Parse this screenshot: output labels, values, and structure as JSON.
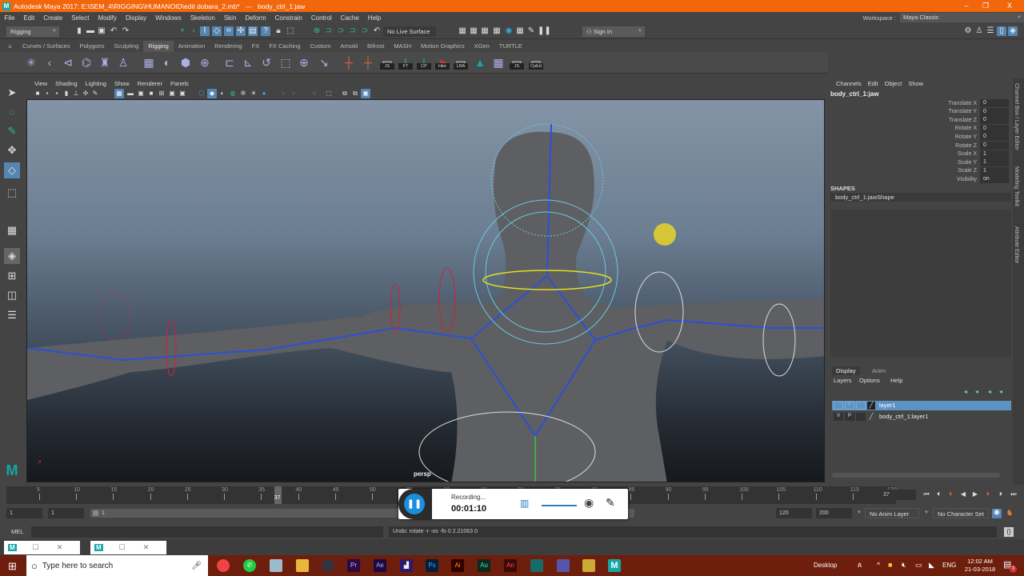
{
  "titlebar": {
    "title": "Autodesk Maya 2017: E:\\SEM_4\\RIGGING\\HUMANOID\\edit dobara_2.mb*   ---   body_ctrl_1:jaw",
    "logo": "M",
    "minimize": "–",
    "restore": "❐",
    "close": "X"
  },
  "menubar": [
    "File",
    "Edit",
    "Create",
    "Select",
    "Modify",
    "Display",
    "Windows",
    "Skeleton",
    "Skin",
    "Deform",
    "Constrain",
    "Control",
    "Cache",
    "Help"
  ],
  "workspace": {
    "label": "Workspace :",
    "value": "Maya Classic"
  },
  "statusline": {
    "menuset": "Rigging",
    "live_surface": "No Live Surface",
    "sign_in": "Sign In"
  },
  "shelf": {
    "tabs": [
      "Curves / Surfaces",
      "Polygons",
      "Sculpting",
      "Rigging",
      "Animation",
      "Rendering",
      "FX",
      "FX Caching",
      "Custom",
      "Arnold",
      "Bifrost",
      "MASH",
      "Motion Graphics",
      "XGen",
      "TURTLE"
    ],
    "active_tab": "Rigging",
    "labeled_buttons": [
      "JS",
      "FT",
      "CP",
      "Hier",
      "LRA",
      "JS",
      "CpEd"
    ]
  },
  "viewport": {
    "menu": [
      "View",
      "Shading",
      "Lighting",
      "Show",
      "Renderer",
      "Panels"
    ],
    "camera_label": "persp"
  },
  "channel_box": {
    "menu": [
      "Channels",
      "Edit",
      "Object",
      "Show"
    ],
    "object_name": "body_ctrl_1:jaw",
    "channels": [
      {
        "label": "Translate X",
        "value": "0"
      },
      {
        "label": "Translate Y",
        "value": "0"
      },
      {
        "label": "Translate Z",
        "value": "0"
      },
      {
        "label": "Rotate X",
        "value": "0"
      },
      {
        "label": "Rotate Y",
        "value": "0"
      },
      {
        "label": "Rotate Z",
        "value": "0"
      },
      {
        "label": "Scale X",
        "value": "1"
      },
      {
        "label": "Scale Y",
        "value": "1"
      },
      {
        "label": "Scale Z",
        "value": "1"
      },
      {
        "label": "Visibility",
        "value": "on"
      }
    ],
    "shapes_header": "SHAPES",
    "shape_name": "body_ctrl_1:jawShape"
  },
  "side_tabs": [
    "Channel Box / Layer Editor",
    "Modeling Toolkit",
    "Attribute Editor"
  ],
  "layer_editor": {
    "tabs": [
      "Display",
      "Anim"
    ],
    "active_tab": "Display",
    "menu": [
      "Layers",
      "Options",
      "Help"
    ],
    "layers": [
      {
        "v": "",
        "p": "P",
        "name": "layer1",
        "selected": true
      },
      {
        "v": "V",
        "p": "P",
        "name": "body_ctrl_1:layer1",
        "selected": false
      }
    ]
  },
  "time_slider": {
    "ticks": [
      "5",
      "10",
      "15",
      "20",
      "25",
      "30",
      "35",
      "40",
      "45",
      "50",
      "55",
      "60",
      "65",
      "70",
      "75",
      "80",
      "85",
      "90",
      "95",
      "100",
      "105",
      "110",
      "115",
      "120"
    ],
    "current_frame": "37",
    "current_frame_field": "37"
  },
  "range_slider": {
    "start_time": "1",
    "playback_start": "1",
    "range_label": "1",
    "playback_end": "120",
    "end_time": "200",
    "anim_layer": "No Anim Layer",
    "character_set": "No Character Set"
  },
  "command_line": {
    "language": "MEL",
    "input": "",
    "result": "Undo: rotate -r -os -fo 0 2.21063 0"
  },
  "recorder": {
    "status": "Recording...",
    "time": "00:01:10"
  },
  "mini_windows": [
    {
      "icon": "M"
    },
    {
      "icon": "M"
    }
  ],
  "taskbar": {
    "search_placeholder": "Type here to search",
    "apps": [
      "Chrome",
      "WhatsApp",
      "Notes",
      "File Explorer",
      "DaVinci",
      "Pr",
      "Ae",
      "Media",
      "Ps",
      "Ai",
      "Au",
      "An",
      "Maya LT",
      "Book",
      "Tool",
      "M"
    ],
    "desktop_label": "Desktop",
    "language": "ENG",
    "time": "12:02 AM",
    "date": "21-03-2018",
    "notifications": "3"
  },
  "colors": {
    "title_bar": "#f2660c",
    "accent_blue": "#5686b0",
    "taskbar": "#6d1e0c",
    "joint_blue": "#2a50d8"
  }
}
